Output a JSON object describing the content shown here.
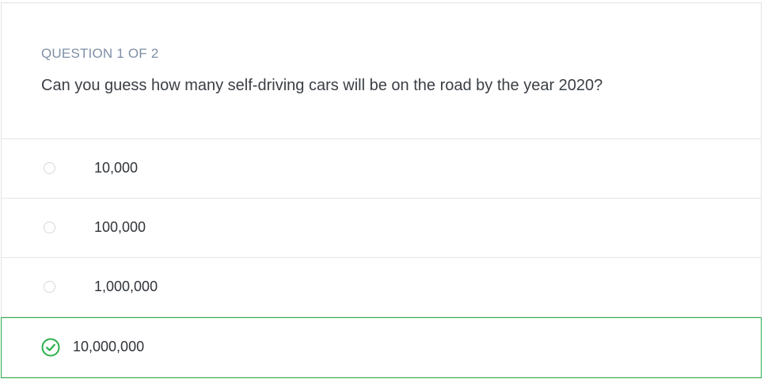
{
  "question": {
    "counter": "QUESTION 1 OF 2",
    "text": "Can you guess how many self-driving cars will be on the road by the year 2020?"
  },
  "options": [
    {
      "label": "10,000",
      "selected": false
    },
    {
      "label": "100,000",
      "selected": false
    },
    {
      "label": "1,000,000",
      "selected": false
    },
    {
      "label": "10,000,000",
      "selected": true
    }
  ],
  "colors": {
    "correct": "#2bb04a",
    "counter": "#7f8fa6",
    "text": "#3a3f45"
  },
  "icons": {
    "selected": "check-circle-icon",
    "unselected": "radio-circle-icon"
  }
}
